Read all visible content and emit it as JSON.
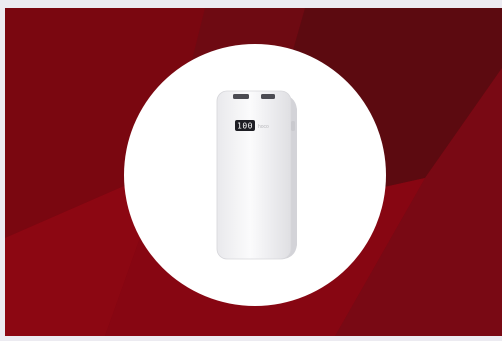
{
  "product": {
    "display_readout": "100",
    "brand_mark": "hoco"
  },
  "colors": {
    "page_background": "#ecebf1",
    "banner_red": "#7e0610",
    "banner_dark": "#5c0a10",
    "circle": "#ffffff"
  }
}
